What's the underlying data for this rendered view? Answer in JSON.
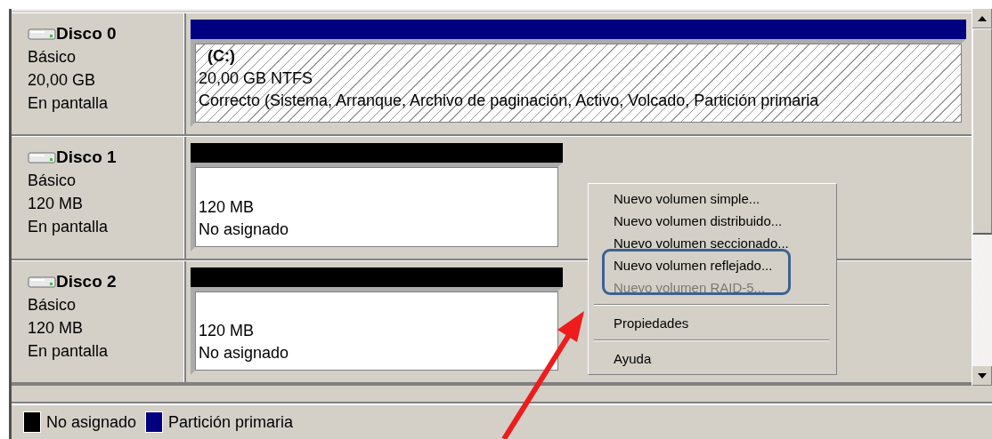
{
  "disks": [
    {
      "name": "Disco 0",
      "type": "Básico",
      "size": "20,00 GB",
      "status": "En pantalla",
      "partitions": [
        {
          "kind": "primary",
          "selected": true,
          "label": "(C:)",
          "size": "20,00 GB NTFS",
          "status": "Correcto (Sistema, Arranque, Archivo de paginación, Activo, Volcado, Partición primaria"
        }
      ]
    },
    {
      "name": "Disco 1",
      "type": "Básico",
      "size": "120 MB",
      "status": "En pantalla",
      "partitions": [
        {
          "kind": "unallocated",
          "selected": false,
          "size": "120 MB",
          "status": "No asignado"
        }
      ]
    },
    {
      "name": "Disco 2",
      "type": "Básico",
      "size": "120 MB",
      "status": "En pantalla",
      "partitions": [
        {
          "kind": "unallocated",
          "selected": false,
          "size": "120 MB",
          "status": "No asignado"
        }
      ]
    }
  ],
  "context_menu": {
    "items": [
      {
        "kind": "item",
        "label": "Nuevo volumen simple...",
        "disabled": false,
        "highlighted": false
      },
      {
        "kind": "item",
        "label": "Nuevo volumen distribuido...",
        "disabled": false,
        "highlighted": false
      },
      {
        "kind": "item",
        "label": "Nuevo volumen seccionado...",
        "disabled": false,
        "highlighted": false
      },
      {
        "kind": "item",
        "label": "Nuevo volumen reflejado...",
        "disabled": false,
        "highlighted": true
      },
      {
        "kind": "item",
        "label": "Nuevo volumen RAID-5...",
        "disabled": true,
        "highlighted": false
      },
      {
        "kind": "separator"
      },
      {
        "kind": "item",
        "label": "Propiedades",
        "disabled": false,
        "highlighted": false
      },
      {
        "kind": "separator"
      },
      {
        "kind": "item",
        "label": "Ayuda",
        "disabled": false,
        "highlighted": false
      }
    ]
  },
  "legend": [
    {
      "label": "No asignado",
      "color": "#000000"
    },
    {
      "label": "Partición primaria",
      "color": "#000080"
    }
  ]
}
